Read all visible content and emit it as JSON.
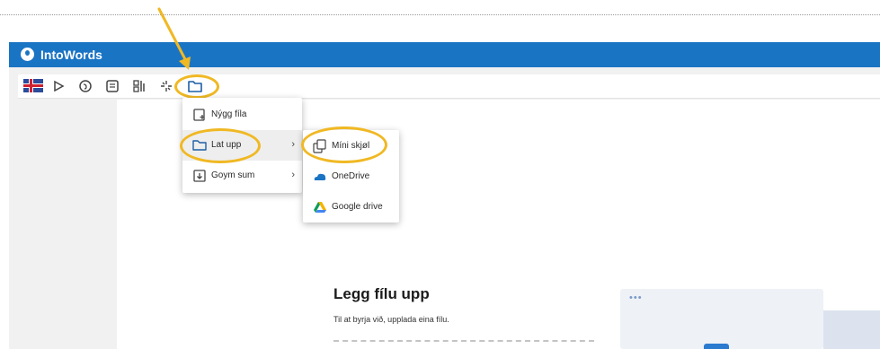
{
  "app": {
    "title": "IntoWords"
  },
  "toolbar": {
    "buttons": [
      {
        "name": "language-flag",
        "icon": "faroese-flag-icon"
      },
      {
        "name": "play",
        "icon": "play-icon"
      },
      {
        "name": "speech",
        "icon": "speech-icon"
      },
      {
        "name": "reader",
        "icon": "reader-icon"
      },
      {
        "name": "word-prediction",
        "icon": "abc-icon"
      },
      {
        "name": "settings",
        "icon": "gear-icon"
      },
      {
        "name": "file",
        "icon": "folder-icon"
      }
    ]
  },
  "file_menu": {
    "items": [
      {
        "label": "Nýgg fíla",
        "icon": "new-file-icon"
      },
      {
        "label": "Lat upp",
        "icon": "folder-icon",
        "has_submenu": true
      },
      {
        "label": "Goym sum",
        "icon": "save-icon",
        "has_submenu": true
      }
    ]
  },
  "open_submenu": {
    "items": [
      {
        "label": "Míni skjøl",
        "icon": "my-documents-icon"
      },
      {
        "label": "OneDrive",
        "icon": "onedrive-icon"
      },
      {
        "label": "Google drive",
        "icon": "google-drive-icon"
      }
    ]
  },
  "upload": {
    "title": "Legg fílu upp",
    "subtitle": "Til at byrja við, upplada eina fílu."
  },
  "colors": {
    "titlebar": "#1a74c4",
    "highlight": "#f0b823",
    "onedrive": "#1a74c4"
  }
}
